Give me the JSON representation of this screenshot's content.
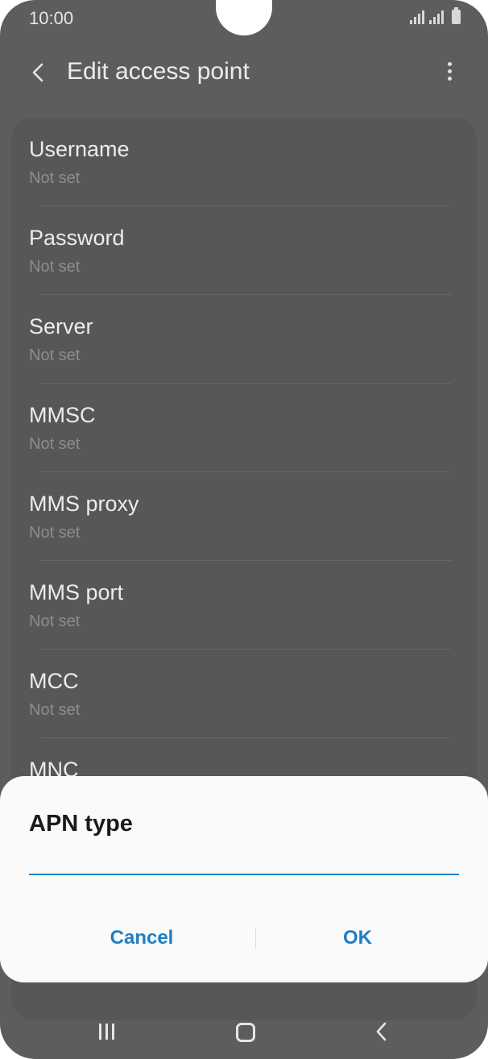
{
  "status_bar": {
    "time": "10:00"
  },
  "app_bar": {
    "title": "Edit access point"
  },
  "settings": [
    {
      "label": "Username",
      "value": "Not set"
    },
    {
      "label": "Password",
      "value": "Not set"
    },
    {
      "label": "Server",
      "value": "Not set"
    },
    {
      "label": "MMSC",
      "value": "Not set"
    },
    {
      "label": "MMS proxy",
      "value": "Not set"
    },
    {
      "label": "MMS port",
      "value": "Not set"
    },
    {
      "label": "MCC",
      "value": "Not set"
    },
    {
      "label": "MNC",
      "value": ""
    }
  ],
  "dialog": {
    "title": "APN type",
    "input_value": "",
    "cancel_label": "Cancel",
    "ok_label": "OK"
  },
  "colors": {
    "accent": "#1f7ec2",
    "scrim": "#5d5d5d",
    "dialog_bg": "#fafafa"
  },
  "icons": {
    "back": "chevron-left-icon",
    "more": "more-vertical-icon",
    "nav_recent": "recent-apps-icon",
    "nav_home": "home-icon",
    "nav_back": "nav-back-icon"
  }
}
